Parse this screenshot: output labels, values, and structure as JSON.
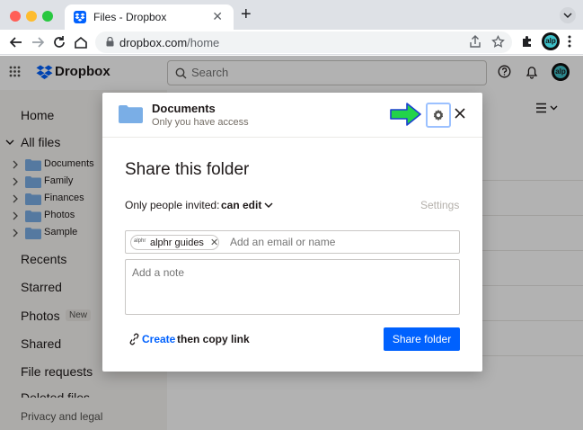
{
  "browser": {
    "tab_title": "Files - Dropbox",
    "tab_close": "✕",
    "new_tab": "+",
    "url_host": "dropbox.com",
    "url_path": "/home",
    "profile_initials": "alp"
  },
  "header": {
    "wordmark": "Dropbox",
    "search_placeholder": "Search",
    "avatar_initials": "alp"
  },
  "sidebar": {
    "home": "Home",
    "all_files": "All files",
    "folders": [
      "Documents",
      "Family",
      "Finances",
      "Photos",
      "Sample"
    ],
    "recents": "Recents",
    "starred": "Starred",
    "photos": "Photos",
    "photos_badge": "New",
    "shared": "Shared",
    "file_requests": "File requests",
    "deleted_files": "Deleted files",
    "privacy": "Privacy and legal"
  },
  "modal": {
    "folder_name": "Documents",
    "access_note": "Only you have access",
    "heading": "Share this folder",
    "invite_label": "Only people invited:",
    "permission": "can edit",
    "settings": "Settings",
    "chip_label": "alphr guides",
    "chip_avatar": "alphr",
    "chip_remove": "✕",
    "email_placeholder": "Add an email or name",
    "note_placeholder": "Add a note",
    "create_word": "Create",
    "copy_word": "then copy link",
    "share_button": "Share folder"
  },
  "colors": {
    "accent": "#0061fe",
    "highlight_arrow": "#22d34a",
    "gear_outline": "#9cc1ff"
  }
}
